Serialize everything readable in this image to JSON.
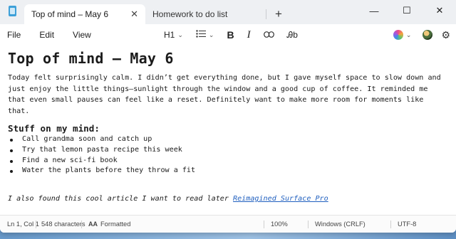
{
  "tabs": [
    {
      "title": "Top of mind – May 6",
      "active": true
    },
    {
      "title": "Homework to do list",
      "active": false
    }
  ],
  "titlebar": {
    "new_tab": "+",
    "minimize": "—",
    "maximize": "☐",
    "close": "✕",
    "tab_close": "✕"
  },
  "menu": {
    "file": "File",
    "edit": "Edit",
    "view": "View"
  },
  "format": {
    "heading": "H1",
    "list_icon": "list-icon",
    "bold": "B",
    "italic": "I",
    "link_icon": "link-icon",
    "clear_format": "Ꭿb"
  },
  "document": {
    "title": "Top of mind – May 6",
    "paragraph": "Today felt surprisingly calm. I didn’t get everything done, but I gave myself space to slow down and just enjoy the little things—sunlight through the window and a good cup of coffee. It reminded me that even small pauses can feel like a reset. Definitely want to make more room for moments like that.",
    "subheading": "Stuff on my mind:",
    "bullets": [
      "Call grandma soon and catch up",
      "Try that lemon pasta recipe this week",
      "Find a new sci-fi book",
      "Water the plants before they throw a fit"
    ],
    "note_text": "I also found this cool article I want to read later ",
    "link_text": "Reimagined Surface Pro"
  },
  "status": {
    "position": "Ln 1, Col 1",
    "characters": "548 characters",
    "mode": "Formatted",
    "zoom": "100%",
    "line_endings": "Windows (CRLF)",
    "encoding": "UTF-8"
  },
  "colors": {
    "accent_link": "#1f5fbf",
    "titlebar_bg": "#eef0f3",
    "tab_active_bg": "#ffffff"
  }
}
